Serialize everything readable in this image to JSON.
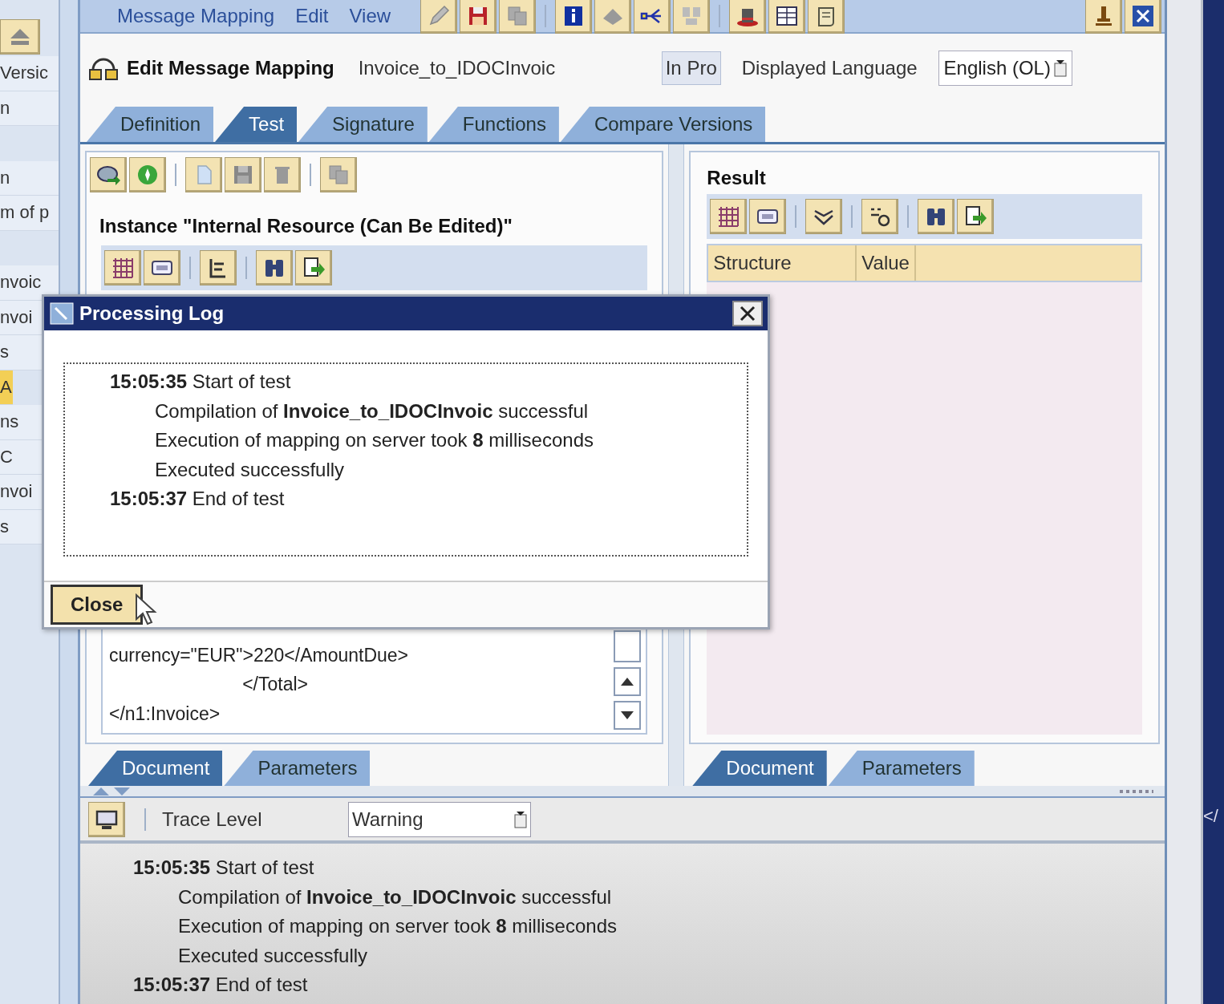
{
  "menu": [
    {
      "label": "Message Mapping"
    },
    {
      "label": "Edit"
    },
    {
      "label": "View"
    }
  ],
  "sidebar": {
    "items": [
      {
        "label": "Versic",
        "selected": false
      },
      {
        "label": "n",
        "selected": false
      },
      {
        "label": "n",
        "selected": false
      },
      {
        "label": "m of p",
        "selected": false
      },
      {
        "label": "nvoic",
        "selected": false
      },
      {
        "label": "nvoi",
        "selected": false
      },
      {
        "label": "s",
        "selected": false
      },
      {
        "label": "A",
        "selected": true
      },
      {
        "label": "ns",
        "selected": false
      },
      {
        "label": "C",
        "selected": false
      },
      {
        "label": "nvoi",
        "selected": false
      },
      {
        "label": "s",
        "selected": false
      }
    ]
  },
  "header": {
    "title": "Edit Message Mapping",
    "object_name": "Invoice_to_IDOCInvoic",
    "status": "In Pro",
    "language_label": "Displayed Language",
    "language": "English (OL)"
  },
  "tabs": [
    {
      "label": "Definition",
      "selected": false
    },
    {
      "label": "Test",
      "selected": true
    },
    {
      "label": "Signature",
      "selected": false
    },
    {
      "label": "Functions",
      "selected": false
    },
    {
      "label": "Compare Versions",
      "selected": false
    }
  ],
  "source": {
    "title": "Instance \"Internal Resource (Can Be Edited)\"",
    "lines": [
      "currency=\"EUR\">220</AmountDue>",
      "                          </Total>",
      "</n1:Invoice>"
    ],
    "tabs": [
      {
        "label": "Document",
        "selected": true
      },
      {
        "label": "Parameters",
        "selected": false
      }
    ]
  },
  "result": {
    "title": "Result",
    "columns": [
      "Structure",
      "Value"
    ],
    "tabs": [
      {
        "label": "Document",
        "selected": true
      },
      {
        "label": "Parameters",
        "selected": false
      }
    ]
  },
  "trace": {
    "label": "Trace Level",
    "value": "Warning",
    "log": [
      {
        "text": "**15:05:35** Start of test",
        "children": [
          {
            "text": "Compilation of **Invoice_to_IDOCInvoic** successful"
          },
          {
            "text": "Execution of mapping on server took **8** milliseconds"
          },
          {
            "text": "Executed successfully"
          }
        ]
      },
      {
        "text": "**15:05:37** End of test"
      }
    ]
  },
  "dialog": {
    "title": "Processing Log",
    "button": "Close",
    "log": [
      {
        "text": "**15:05:35** Start of test",
        "children": [
          {
            "text": "Compilation of **Invoice_to_IDOCInvoic** successful"
          },
          {
            "text": "Execution of mapping on server took **8** milliseconds"
          },
          {
            "text": "Executed successfully"
          }
        ]
      },
      {
        "text": "**15:05:37** End of test"
      }
    ]
  },
  "edge_text": "</"
}
